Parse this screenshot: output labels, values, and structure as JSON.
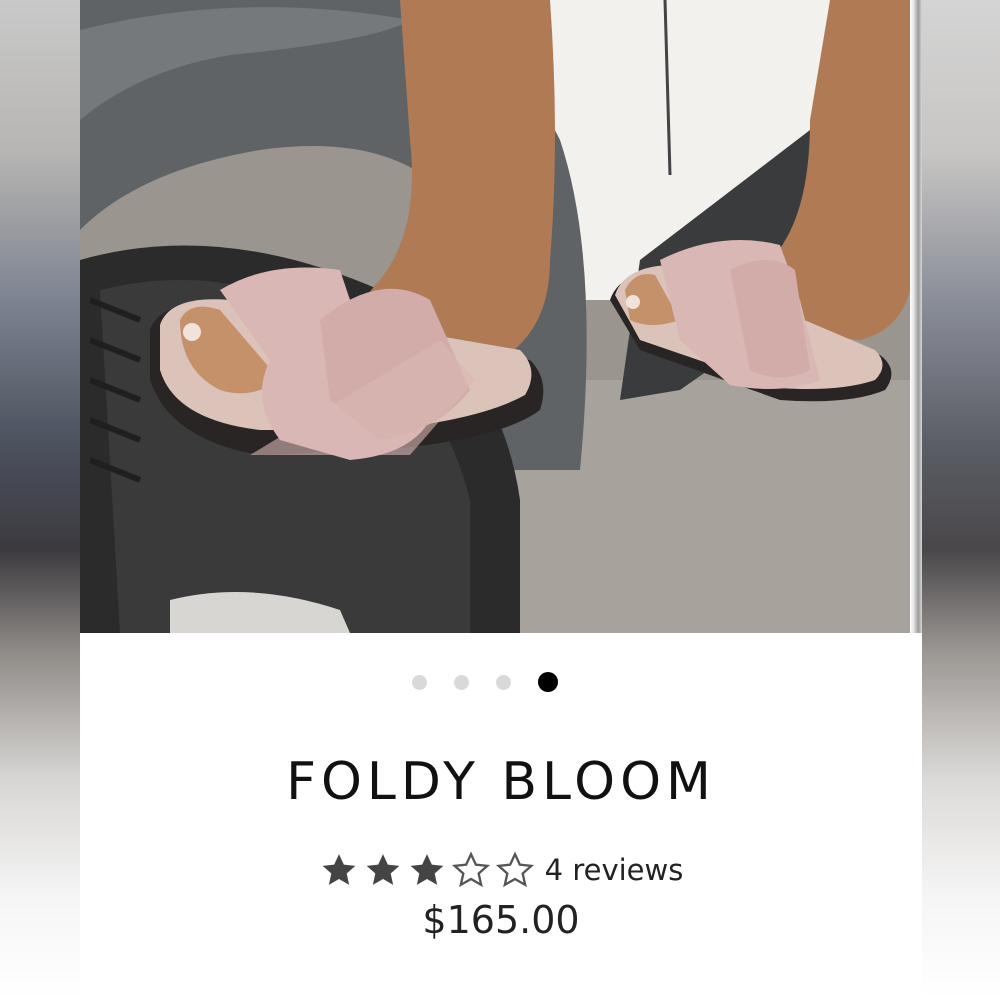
{
  "product": {
    "title": "FOLDY BLOOM",
    "rating": 3,
    "rating_max": 5,
    "reviews_label": "4 reviews",
    "price": "$165.00"
  },
  "carousel": {
    "slide_count": 4,
    "active_index": 3,
    "image_description_icon": "product-photo"
  },
  "colors": {
    "star_filled": "#444444",
    "star_empty": "#555555",
    "dot_active": "#000000",
    "dot_inactive": "#d9d9d9",
    "sandal_pink": "#d9b7b4"
  }
}
